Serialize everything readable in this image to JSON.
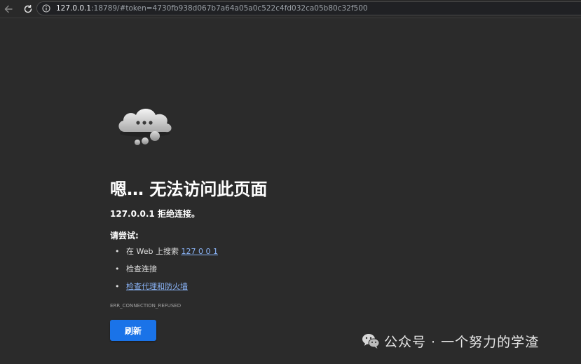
{
  "browser": {
    "url_host": "127.0.0.1",
    "url_rest": ":18789/#token=4730fb938d067b7a64a05a0c522c4fd032ca05b80c32f500"
  },
  "error_page": {
    "title": "嗯… 无法访问此页面",
    "refused_host": "127.0.0.1",
    "refused_text": " 拒绝连接。",
    "try_heading": "请尝试:",
    "suggestions": [
      {
        "prefix": "在 Web 上搜索 ",
        "link": "127 0 0 1"
      },
      {
        "prefix": "检查连接",
        "link": ""
      },
      {
        "prefix": "",
        "link": "检查代理和防火墙"
      }
    ],
    "error_code": "ERR_CONNECTION_REFUSED",
    "refresh_label": "刷新"
  },
  "watermark": {
    "text": "公众号 · 一个努力的学渣"
  },
  "colors": {
    "page_background": "#2b2b2b",
    "button_blue": "#1a73e8",
    "link_blue": "#8ab4f8"
  },
  "icons": {
    "back": "arrow-left-icon",
    "reload": "reload-icon",
    "site_info": "info-circle-icon",
    "illustration": "cloud-with-dots-icon",
    "watermark_logo": "wechat-logo-icon"
  }
}
